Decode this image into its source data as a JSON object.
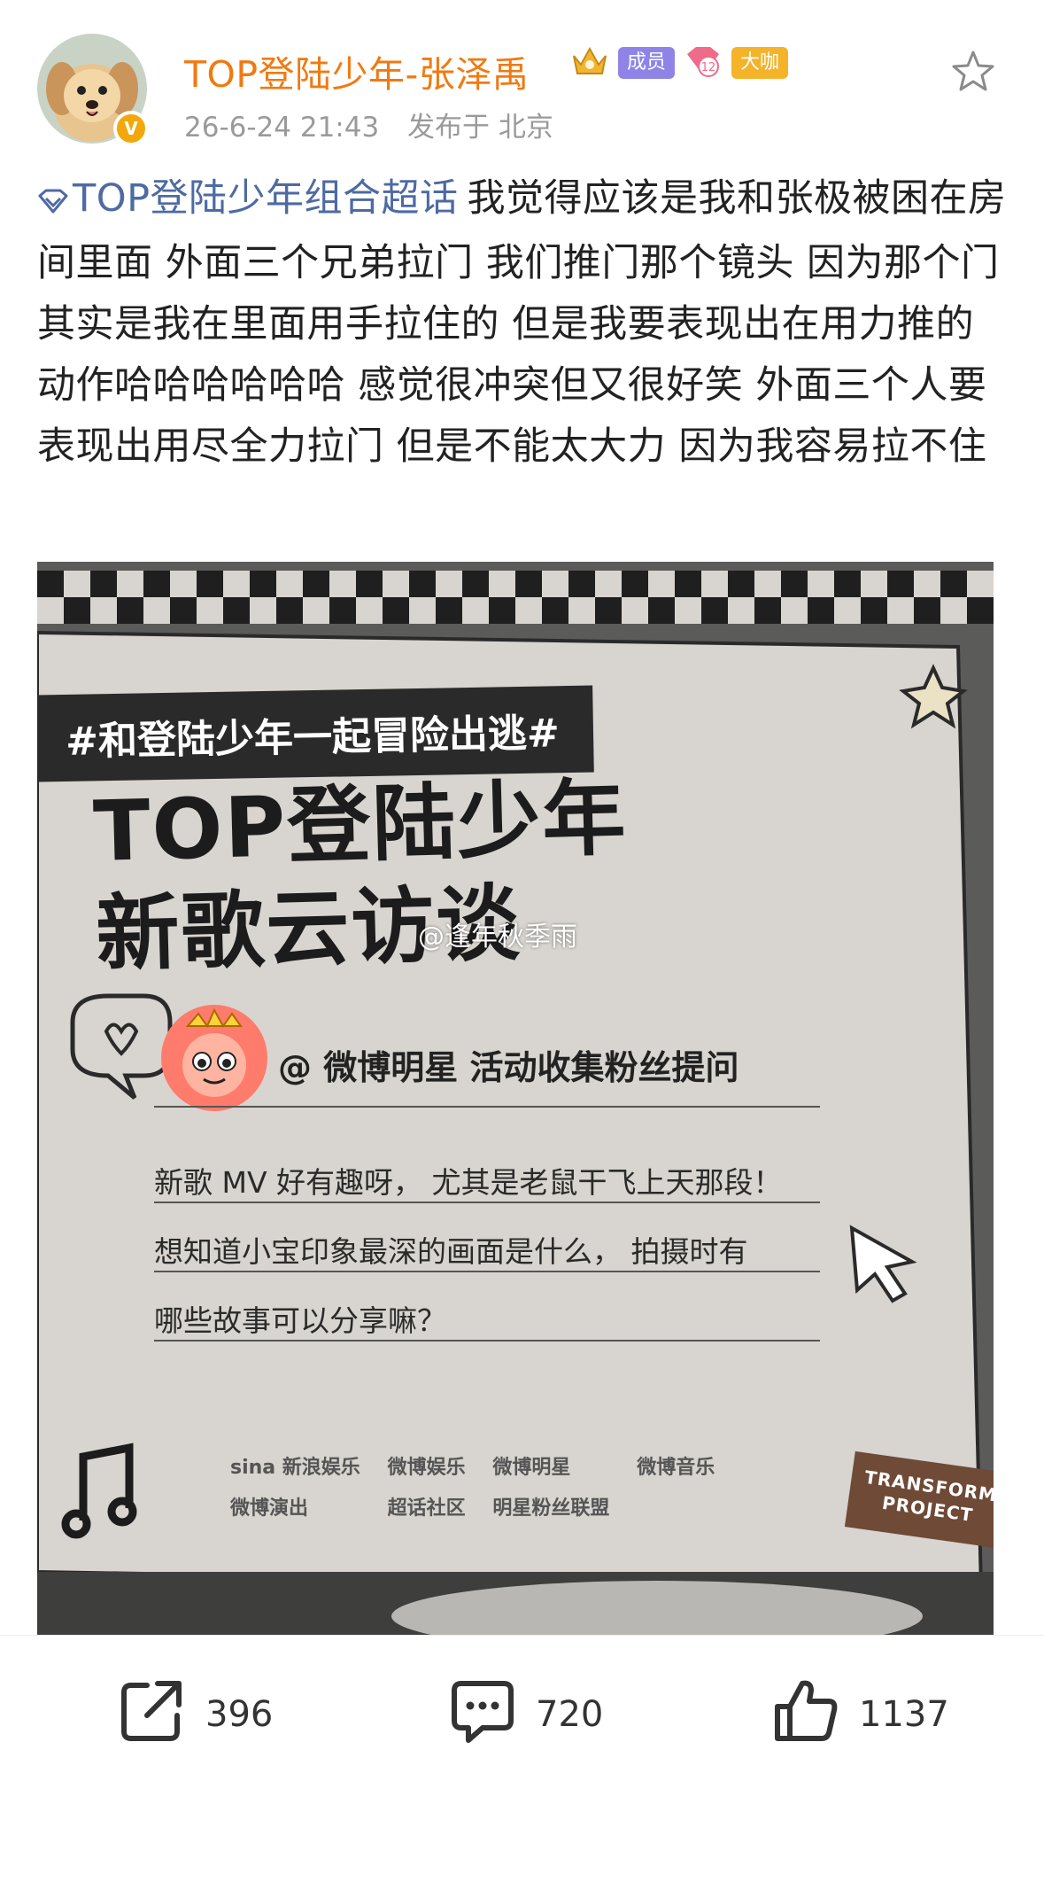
{
  "header": {
    "username": "TOP登陆少年-张泽禹",
    "verified_mark": "V",
    "badges": {
      "member": "成员",
      "vip": "大咖",
      "level": "12"
    },
    "date": "26-6-24 21:43",
    "location": "发布于 北京"
  },
  "post": {
    "topic": "TOP登陆少年组合超话",
    "text": "我觉得应该是我和张极被困在房间里面 外面三个兄弟拉门 我们推门那个镜头 因为那个门其实是我在里面用手拉住的 但是我要表现出在用力推的动作哈哈哈哈哈哈 感觉很冲突但又很好笑 外面三个人要表现出用尽全力拉门 但是不能太大力 因为我容易拉不住"
  },
  "poster": {
    "hashtag": "#和登陆少年一起冒险出逃#",
    "title_line1": "TOP登陆少年",
    "title_line2": "新歌云访谈",
    "watermark": "@逢年秋季雨",
    "mention": "@ 微博明星  活动收集粉丝提问",
    "question_line1": "新歌 MV 好有趣呀， 尤其是老鼠干飞上天那段！",
    "question_line2": "想知道小宝印象最深的画面是什么， 拍摄时有",
    "question_line3": "哪些故事可以分享嘛？",
    "logos": [
      "sina 新浪娱乐",
      "微博娱乐",
      "微博明星",
      "微博音乐",
      "微博演出",
      "超话社区",
      "明星粉丝联盟"
    ],
    "badge_line1": "TRANSFORM",
    "badge_line2": "PROJECT"
  },
  "actions": {
    "share_count": "396",
    "comment_count": "720",
    "like_count": "1137"
  },
  "colors": {
    "username": "#f07a12",
    "topic_link": "#4d6aa3",
    "meta_text": "#9a9a9a",
    "member_badge": "#8f83e8",
    "vip_badge": "#f5b32a"
  },
  "icons": [
    "star-outline-icon",
    "share-icon",
    "comment-icon",
    "like-icon",
    "super-topic-icon"
  ]
}
